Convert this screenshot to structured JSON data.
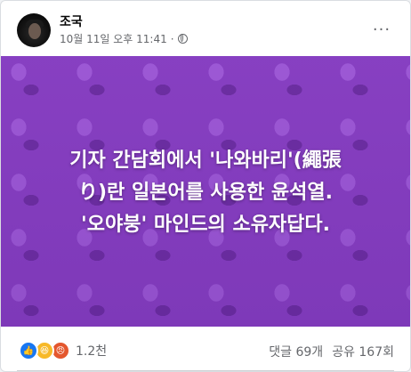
{
  "post": {
    "author": "조국",
    "timestamp": "10월 11일 오후 11:41",
    "separator": "·",
    "privacy_icon": "globe-icon",
    "more_icon": "more-options-icon",
    "image": {
      "background_color": "#8a42c4",
      "headline_lines": [
        "기자 간담회에서 '나와바리'(繩張",
        "り)란 일본어를 사용한 윤석열.",
        "'오야붕' 마인드의 소유자답다."
      ]
    },
    "reactions": {
      "icons": [
        "like-icon",
        "haha-icon",
        "angry-icon"
      ],
      "count": "1.2천"
    },
    "comments": "댓글 69개",
    "shares": "공유 167회"
  }
}
